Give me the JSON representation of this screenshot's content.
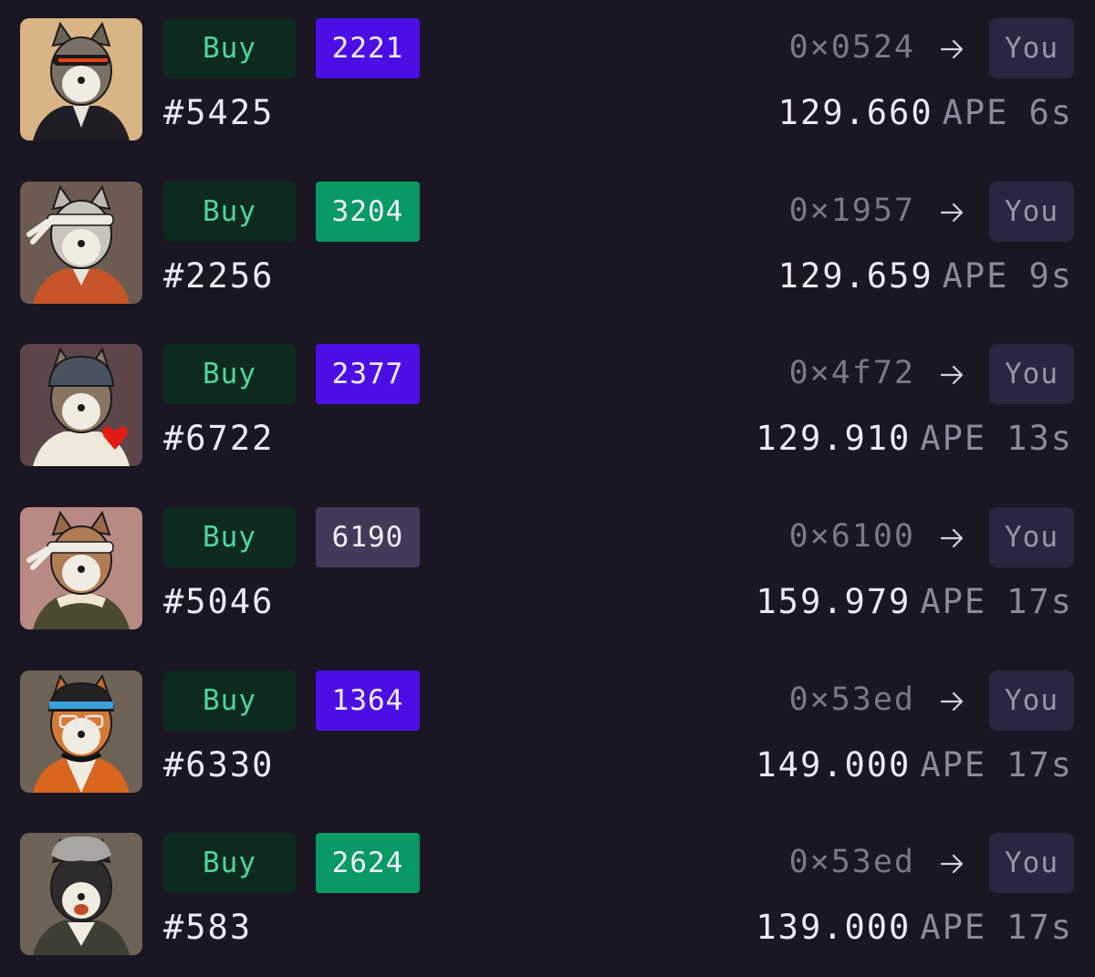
{
  "feed": {
    "rows": [
      {
        "buy_label": "Buy",
        "rank": "2221",
        "rank_color": "#4b0fe6",
        "token_id": "#5425",
        "from_address": "0×0524",
        "to_label": "You",
        "price": "129.660",
        "currency": "APE",
        "age": "6s",
        "avatar_bg": "#d9b487"
      },
      {
        "buy_label": "Buy",
        "rank": "3204",
        "rank_color": "#079a62",
        "token_id": "#2256",
        "from_address": "0×1957",
        "to_label": "You",
        "price": "129.659",
        "currency": "APE",
        "age": "9s",
        "avatar_bg": "#6d5b52"
      },
      {
        "buy_label": "Buy",
        "rank": "2377",
        "rank_color": "#4b0fe6",
        "token_id": "#6722",
        "from_address": "0×4f72",
        "to_label": "You",
        "price": "129.910",
        "currency": "APE",
        "age": "13s",
        "avatar_bg": "#5c4649"
      },
      {
        "buy_label": "Buy",
        "rank": "6190",
        "rank_color": "#433a5a",
        "token_id": "#5046",
        "from_address": "0×6100",
        "to_label": "You",
        "price": "159.979",
        "currency": "APE",
        "age": "17s",
        "avatar_bg": "#b98a84"
      },
      {
        "buy_label": "Buy",
        "rank": "1364",
        "rank_color": "#4b0fe6",
        "token_id": "#6330",
        "from_address": "0×53ed",
        "to_label": "You",
        "price": "149.000",
        "currency": "APE",
        "age": "17s",
        "avatar_bg": "#6e6156"
      },
      {
        "buy_label": "Buy",
        "rank": "2624",
        "rank_color": "#079a62",
        "token_id": "#583",
        "from_address": "0×53ed",
        "to_label": "You",
        "price": "139.000",
        "currency": "APE",
        "age": "17s",
        "avatar_bg": "#6e6156"
      }
    ]
  },
  "icons": {
    "avatar": "cat-nft-avatar-icon",
    "arrow": "arrow-right-icon"
  }
}
